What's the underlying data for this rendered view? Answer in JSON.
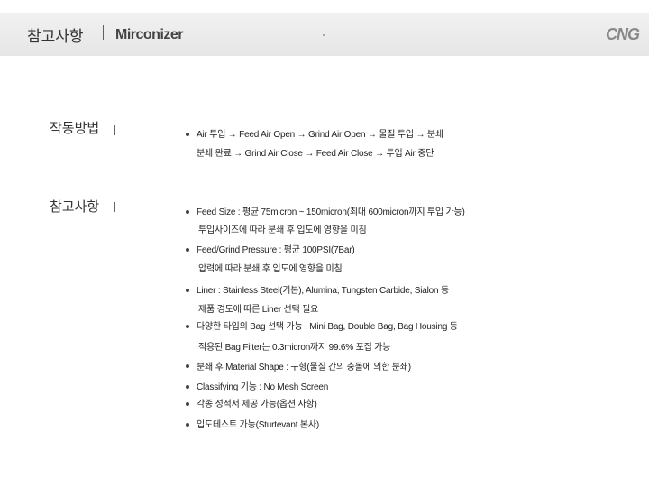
{
  "header": {
    "title": "참고사항",
    "subtitle": "Mirconizer",
    "logo_text": "CNG"
  },
  "operation": {
    "title": "작동방법",
    "line1": "Air 투입 → Feed Air Open → Grind Air Open → 물질 투입 → 분쇄",
    "line2": "분쇄 완료 → Grind Air Close → Feed Air Close → 투입 Air 중단"
  },
  "notes": {
    "title": "참고사항",
    "items": [
      {
        "text": "Feed Size : 평균 75micron ~ 150micron(최대 600micron까지 투입 가능)",
        "sub": "투입사이즈에 따라 분쇄 후 입도에 영향을 미침"
      },
      {
        "text": "Feed/Grind Pressure : 평균 100PSI(7Bar)",
        "sub": "압력에 따라 분쇄 후 입도에 영향을 미침"
      },
      {
        "text": "Liner : Stainless Steel(기본), Alumina, Tungsten Carbide, Sialon 등",
        "sub": "제품 경도에 따른 Liner 선택 필요"
      },
      {
        "text": "다양한 타입의 Bag 선택 가능 : Mini Bag, Double Bag, Bag Housing 등",
        "sub": "적용된 Bag Filter는 0.3micron까지 99.6% 포집 가능"
      },
      {
        "text": "분쇄 후 Material Shape : 구형(물질 간의 충돌에 의한 분쇄)"
      },
      {
        "text": "Classifying 기능 : No Mesh Screen"
      },
      {
        "text": "각종 성적서 제공 가능(옵션 사항)"
      },
      {
        "text": "입도테스트 가능(Sturtevant 본사)"
      }
    ]
  }
}
